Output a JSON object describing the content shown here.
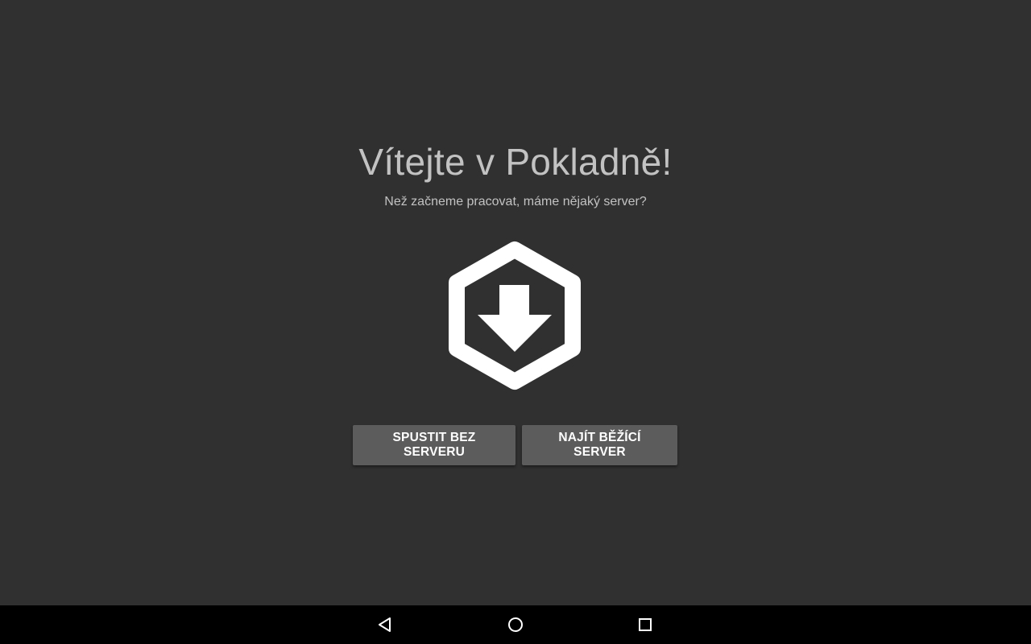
{
  "welcome": {
    "title": "Vítejte v Pokladně!",
    "subtitle": "Než začneme pracovat, máme nějaký server?",
    "logo_icon": "hexagon-download-icon"
  },
  "actions": {
    "start_without_server_label": "SPUSTIT BEZ SERVERU",
    "find_running_server_label": "NAJÍT BĚŽÍCÍ SERVER"
  },
  "navigation_bar": {
    "back_icon": "back-triangle-icon",
    "home_icon": "home-circle-icon",
    "recents_icon": "recents-square-icon"
  },
  "colors": {
    "background": "#303030",
    "text": "#c2c2c2",
    "button_background": "#5c5c5c",
    "button_text": "#ffffff",
    "navbar_background": "#000000"
  }
}
